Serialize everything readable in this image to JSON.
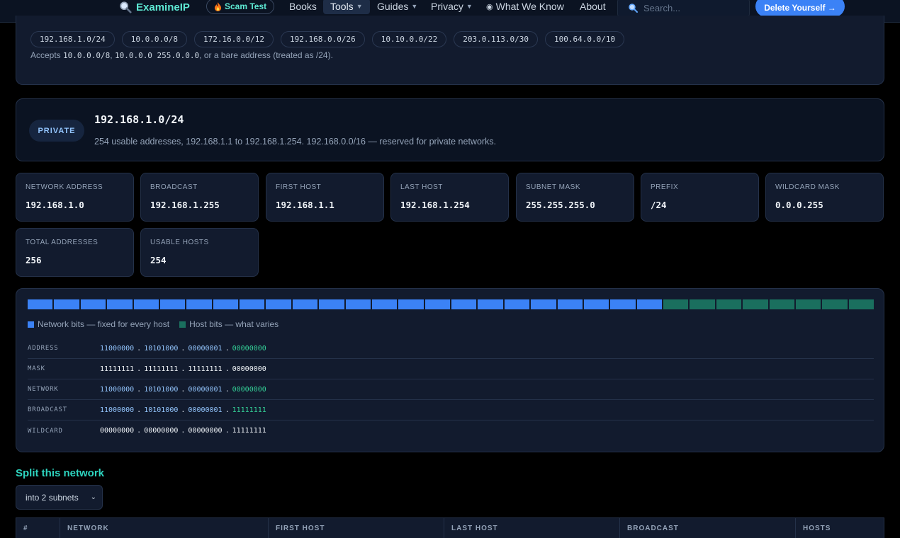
{
  "nav": {
    "brand": "ExamineIP",
    "scam_test": "Scam Test",
    "books": "Books",
    "tools": "Tools",
    "guides": "Guides",
    "privacy": "Privacy",
    "what_we_know": "What We Know",
    "about": "About",
    "search_placeholder": "Search...",
    "delete_button": "Delete Yourself →"
  },
  "input": {
    "examples": [
      "192.168.1.0/24",
      "10.0.0.0/8",
      "172.16.0.0/12",
      "192.168.0.0/26",
      "10.10.0.0/22",
      "203.0.113.0/30",
      "100.64.0.0/10"
    ],
    "accepts_prefix": "Accepts",
    "accepts_code1": "10.0.0.0/8",
    "accepts_sep1": ",",
    "accepts_code2": "10.0.0.0 255.0.0.0",
    "accepts_suffix": ", or a bare address (treated as /24)."
  },
  "result": {
    "badge": "PRIVATE",
    "title": "192.168.1.0/24",
    "description": "254 usable addresses, 192.168.1.1 to 192.168.1.254. 192.168.0.0/16 — reserved for private networks."
  },
  "stats": [
    {
      "label": "Network Address",
      "value": "192.168.1.0"
    },
    {
      "label": "Broadcast",
      "value": "192.168.1.255"
    },
    {
      "label": "First Host",
      "value": "192.168.1.1"
    },
    {
      "label": "Last Host",
      "value": "192.168.1.254"
    },
    {
      "label": "Subnet Mask",
      "value": "255.255.255.0"
    },
    {
      "label": "Prefix",
      "value": "/24"
    },
    {
      "label": "Wildcard Mask",
      "value": "0.0.0.255"
    },
    {
      "label": "Total Addresses",
      "value": "256"
    },
    {
      "label": "Usable Hosts",
      "value": "254"
    }
  ],
  "bits": {
    "network_bits": 24,
    "total_bits": 32,
    "network_color": "#3b82f6",
    "host_color": "#1a6f5e",
    "legend_network": "Network bits — fixed for every host",
    "legend_host": "Host bits — what varies",
    "rows": [
      {
        "label": "Address",
        "octets": [
          "11000000",
          "10101000",
          "00000001",
          "00000000"
        ]
      },
      {
        "label": "Mask",
        "octets": [
          "11111111",
          "11111111",
          "11111111",
          "00000000"
        ]
      },
      {
        "label": "Network",
        "octets": [
          "11000000",
          "10101000",
          "00000001",
          "00000000"
        ]
      },
      {
        "label": "Broadcast",
        "octets": [
          "11000000",
          "10101000",
          "00000001",
          "11111111"
        ]
      },
      {
        "label": "Wildcard",
        "octets": [
          "00000000",
          "00000000",
          "00000000",
          "11111111"
        ]
      }
    ]
  },
  "split": {
    "title": "Split this network",
    "selected": "into 2 subnets",
    "columns": [
      "#",
      "Network",
      "First Host",
      "Last Host",
      "Broadcast",
      "Hosts"
    ]
  }
}
